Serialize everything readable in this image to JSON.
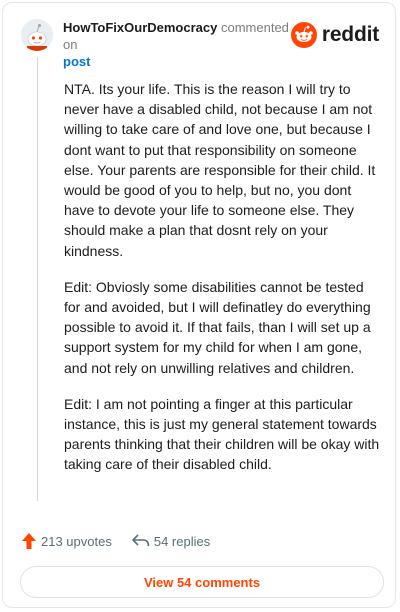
{
  "header": {
    "username": "HowToFixOurDemocracy",
    "commented_text": "commented on",
    "post_link": "post",
    "brand": "reddit",
    "brand_color": "#ff4500"
  },
  "comment": {
    "paragraphs": [
      "NTA. Its your life. This is the reason I will try to never have a disabled child, not because I am not willing to take care of and love one, but because I dont want to put that responsibility on someone else. Your parents are responsible for their child. It would be good of you to help, but no, you dont have to devote your life to someone else. They should make a plan that dosnt rely on your kindness.",
      "Edit: Obviosly some disabilities cannot be tested for and avoided, but I will definatley do everything possible to avoid it. If that fails, than I will set up a support system for my child for when I am gone, and not rely on unwilling relatives and children.",
      "Edit: I am not pointing a finger at this particular instance, this is just my general statement towards parents thinking that their children will be okay with taking care of their disabled child."
    ]
  },
  "actions": {
    "upvotes": "213 upvotes",
    "replies": "54 replies",
    "upvote_icon": "upvote-arrow-icon",
    "reply_icon": "reply-arrow-icon"
  },
  "footer": {
    "view_comments": "View 54 comments"
  }
}
